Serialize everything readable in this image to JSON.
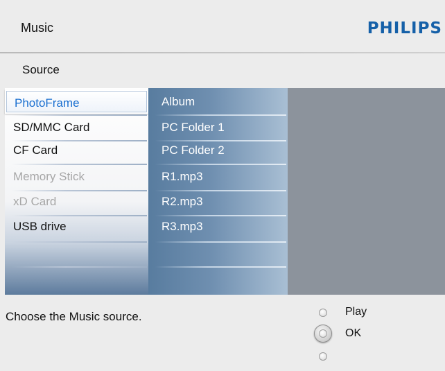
{
  "header": {
    "title": "Music",
    "brand": "PHILIPS"
  },
  "subheader": {
    "title": "Source"
  },
  "sources": [
    {
      "label": "PhotoFrame",
      "state": "selected"
    },
    {
      "label": "SD/MMC Card",
      "state": "enabled"
    },
    {
      "label": "CF Card",
      "state": "enabled"
    },
    {
      "label": "Memory Stick",
      "state": "disabled"
    },
    {
      "label": "xD Card",
      "state": "disabled"
    },
    {
      "label": "USB drive",
      "state": "enabled"
    }
  ],
  "contents": [
    {
      "label": "Album"
    },
    {
      "label": "PC Folder 1"
    },
    {
      "label": "PC Folder 2"
    },
    {
      "label": "R1.mp3"
    },
    {
      "label": "R2.mp3"
    },
    {
      "label": "R3.mp3"
    }
  ],
  "footer": {
    "hint": "Choose the Music source.",
    "controls": {
      "play_label": "Play",
      "ok_label": "OK"
    }
  },
  "colors": {
    "brand": "#1560a8",
    "selected_text": "#1a6fd0",
    "disabled_text": "#a7a7a7"
  }
}
